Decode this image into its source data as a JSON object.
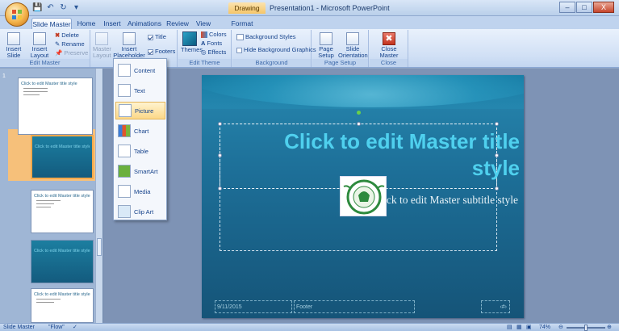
{
  "window": {
    "contextual_tab": "Drawing Tools",
    "title": "Presentation1 - Microsoft PowerPoint",
    "minimize": "–",
    "maximize": "□",
    "close": "X"
  },
  "tabs": [
    "Slide Master",
    "Home",
    "Insert",
    "Animations",
    "Review",
    "View",
    "Format"
  ],
  "ribbon": {
    "edit_master": {
      "insert_slide_master": "Insert Slide Master",
      "insert_layout": "Insert Layout",
      "delete": "Delete",
      "rename": "Rename",
      "preserve": "Preserve",
      "label": "Edit Master"
    },
    "master_layout": {
      "master_layout": "Master Layout",
      "insert_placeholder": "Insert Placeholder",
      "title": "Title",
      "footers": "Footers",
      "title_checked": true,
      "footers_checked": true
    },
    "edit_theme": {
      "themes": "Themes",
      "colors": "Colors",
      "fonts": "Fonts",
      "effects": "Effects",
      "label": "Edit Theme"
    },
    "background": {
      "background_styles": "Background Styles",
      "hide_background": "Hide Background Graphics",
      "label": "Background"
    },
    "page_setup": {
      "page_setup": "Page Setup",
      "slide_orientation": "Slide Orientation",
      "label": "Page Setup"
    },
    "close": {
      "close_master_view": "Close Master View",
      "label": "Close"
    }
  },
  "placeholder_menu": {
    "items": [
      {
        "label": "Content",
        "icon": "content-icon"
      },
      {
        "label": "Text",
        "icon": "text-icon"
      },
      {
        "label": "Picture",
        "icon": "picture-icon",
        "highlighted": true
      },
      {
        "label": "Chart",
        "icon": "chart-icon"
      },
      {
        "label": "Table",
        "icon": "table-icon"
      },
      {
        "label": "SmartArt",
        "icon": "smartart-icon"
      },
      {
        "label": "Media",
        "icon": "media-icon"
      },
      {
        "label": "Clip Art",
        "icon": "clipart-icon"
      }
    ]
  },
  "thumbnails": {
    "master_number": "1",
    "items": [
      {
        "title": "Click to edit Master title style",
        "style": "white"
      },
      {
        "title": "Click to edit Master title style",
        "style": "teal",
        "selected": true
      },
      {
        "title": "Click to edit Master title style",
        "style": "white"
      },
      {
        "title": "Click to edit Master title style",
        "style": "teal"
      },
      {
        "title": "Click to edit Master title style",
        "style": "white"
      }
    ]
  },
  "slide": {
    "title_line1": "Click to edit Master title",
    "title_line2": "style",
    "subtitle": "Click to edit Master subtitle style",
    "date": "9/11/2015",
    "footer": "Footer",
    "page_number": "‹#›"
  },
  "statusbar": {
    "view": "Slide Master",
    "theme": "\"Flow\"",
    "zoom": "74%"
  },
  "colors": {
    "ribbon_bg": "#d1e0f5",
    "slide_bg": "#1d6f98",
    "title_color": "#4fd0ee",
    "highlight": "#fcd888"
  }
}
